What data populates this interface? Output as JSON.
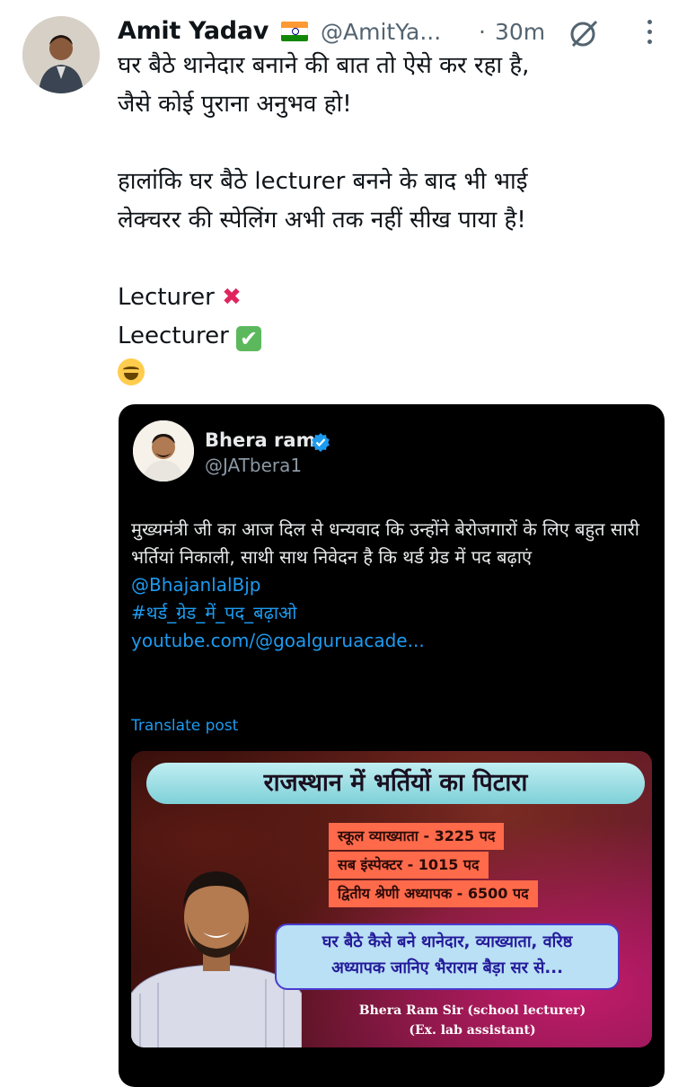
{
  "tweet": {
    "author_name": "Amit Yadav",
    "handle": "@AmitYa...",
    "separator": "·",
    "time": "30m",
    "body": "घर बैठे थानेदार बनाने की बात तो ऐसे कर रहा है,\nजैसे कोई पुराना अनुभव हो!\n\nहालांकि घर बैठे lecturer बनने के बाद भी भाई\nलेक्चरर की स्पेलिंग अभी तक नहीं सीख पाया है!\n",
    "line_wrong": "Lecturer",
    "line_right": "Leecturer",
    "icons": [
      "grok-icon",
      "more-options-icon"
    ],
    "flag_colors": [
      "#ff9933",
      "#ffffff",
      "#138808"
    ]
  },
  "quote": {
    "author_name": "Bhera ram",
    "handle": "@JATbera1",
    "text_main": "मुख्यमंत्री जी का आज दिल से धन्यवाद कि उन्होंने बेरोजगारों के लिए बहुत सारी भर्तियां निकाली, साथी साथ निवेदन है कि थर्ड ग्रेड में पद बढ़ाएं ",
    "mention": "@BhajanlalBjp",
    "hashtag": "#थर्ड_ग्रेड_में_पद_बढ़ाओ",
    "url": "youtube.com/@goalguruacade...",
    "translate": "Translate post",
    "verified_color": "#1d9bf0"
  },
  "banner": {
    "title": "राजस्थान में भर्तियों का पिटारा",
    "line1": "स्कूल व्याख्याता - 3225 पद",
    "line2": "सब इंस्पेक्टर - 1015 पद",
    "line3": "द्वितीय श्रेणी अध्यापक - 6500 पद",
    "promo1": "घर बैठे कैसे बने थानेदार, व्याख्याता, वरिष्ठ",
    "promo2": "अध्यापक जानिए भैराराम बैड़ा सर से...",
    "name1": "Bhera Ram Sir (school lecturer)",
    "name2": "(Ex. lab assistant)"
  }
}
